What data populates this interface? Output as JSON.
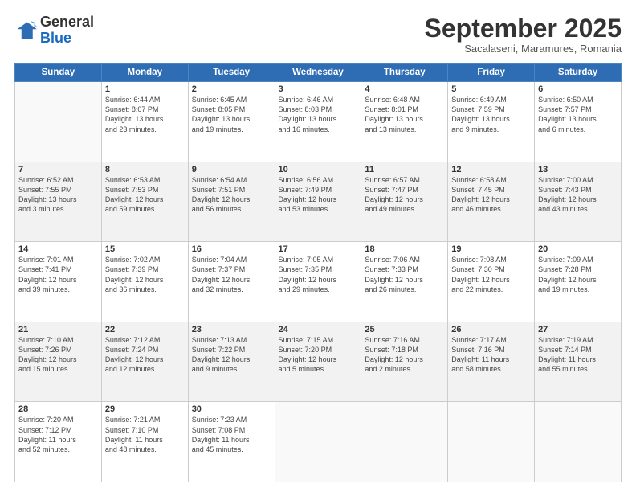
{
  "logo": {
    "general": "General",
    "blue": "Blue"
  },
  "header": {
    "month": "September 2025",
    "location": "Sacalaseni, Maramures, Romania"
  },
  "weekdays": [
    "Sunday",
    "Monday",
    "Tuesday",
    "Wednesday",
    "Thursday",
    "Friday",
    "Saturday"
  ],
  "weeks": [
    [
      {
        "day": "",
        "info": ""
      },
      {
        "day": "1",
        "info": "Sunrise: 6:44 AM\nSunset: 8:07 PM\nDaylight: 13 hours\nand 23 minutes."
      },
      {
        "day": "2",
        "info": "Sunrise: 6:45 AM\nSunset: 8:05 PM\nDaylight: 13 hours\nand 19 minutes."
      },
      {
        "day": "3",
        "info": "Sunrise: 6:46 AM\nSunset: 8:03 PM\nDaylight: 13 hours\nand 16 minutes."
      },
      {
        "day": "4",
        "info": "Sunrise: 6:48 AM\nSunset: 8:01 PM\nDaylight: 13 hours\nand 13 minutes."
      },
      {
        "day": "5",
        "info": "Sunrise: 6:49 AM\nSunset: 7:59 PM\nDaylight: 13 hours\nand 9 minutes."
      },
      {
        "day": "6",
        "info": "Sunrise: 6:50 AM\nSunset: 7:57 PM\nDaylight: 13 hours\nand 6 minutes."
      }
    ],
    [
      {
        "day": "7",
        "info": "Sunrise: 6:52 AM\nSunset: 7:55 PM\nDaylight: 13 hours\nand 3 minutes."
      },
      {
        "day": "8",
        "info": "Sunrise: 6:53 AM\nSunset: 7:53 PM\nDaylight: 12 hours\nand 59 minutes."
      },
      {
        "day": "9",
        "info": "Sunrise: 6:54 AM\nSunset: 7:51 PM\nDaylight: 12 hours\nand 56 minutes."
      },
      {
        "day": "10",
        "info": "Sunrise: 6:56 AM\nSunset: 7:49 PM\nDaylight: 12 hours\nand 53 minutes."
      },
      {
        "day": "11",
        "info": "Sunrise: 6:57 AM\nSunset: 7:47 PM\nDaylight: 12 hours\nand 49 minutes."
      },
      {
        "day": "12",
        "info": "Sunrise: 6:58 AM\nSunset: 7:45 PM\nDaylight: 12 hours\nand 46 minutes."
      },
      {
        "day": "13",
        "info": "Sunrise: 7:00 AM\nSunset: 7:43 PM\nDaylight: 12 hours\nand 43 minutes."
      }
    ],
    [
      {
        "day": "14",
        "info": "Sunrise: 7:01 AM\nSunset: 7:41 PM\nDaylight: 12 hours\nand 39 minutes."
      },
      {
        "day": "15",
        "info": "Sunrise: 7:02 AM\nSunset: 7:39 PM\nDaylight: 12 hours\nand 36 minutes."
      },
      {
        "day": "16",
        "info": "Sunrise: 7:04 AM\nSunset: 7:37 PM\nDaylight: 12 hours\nand 32 minutes."
      },
      {
        "day": "17",
        "info": "Sunrise: 7:05 AM\nSunset: 7:35 PM\nDaylight: 12 hours\nand 29 minutes."
      },
      {
        "day": "18",
        "info": "Sunrise: 7:06 AM\nSunset: 7:33 PM\nDaylight: 12 hours\nand 26 minutes."
      },
      {
        "day": "19",
        "info": "Sunrise: 7:08 AM\nSunset: 7:30 PM\nDaylight: 12 hours\nand 22 minutes."
      },
      {
        "day": "20",
        "info": "Sunrise: 7:09 AM\nSunset: 7:28 PM\nDaylight: 12 hours\nand 19 minutes."
      }
    ],
    [
      {
        "day": "21",
        "info": "Sunrise: 7:10 AM\nSunset: 7:26 PM\nDaylight: 12 hours\nand 15 minutes."
      },
      {
        "day": "22",
        "info": "Sunrise: 7:12 AM\nSunset: 7:24 PM\nDaylight: 12 hours\nand 12 minutes."
      },
      {
        "day": "23",
        "info": "Sunrise: 7:13 AM\nSunset: 7:22 PM\nDaylight: 12 hours\nand 9 minutes."
      },
      {
        "day": "24",
        "info": "Sunrise: 7:15 AM\nSunset: 7:20 PM\nDaylight: 12 hours\nand 5 minutes."
      },
      {
        "day": "25",
        "info": "Sunrise: 7:16 AM\nSunset: 7:18 PM\nDaylight: 12 hours\nand 2 minutes."
      },
      {
        "day": "26",
        "info": "Sunrise: 7:17 AM\nSunset: 7:16 PM\nDaylight: 11 hours\nand 58 minutes."
      },
      {
        "day": "27",
        "info": "Sunrise: 7:19 AM\nSunset: 7:14 PM\nDaylight: 11 hours\nand 55 minutes."
      }
    ],
    [
      {
        "day": "28",
        "info": "Sunrise: 7:20 AM\nSunset: 7:12 PM\nDaylight: 11 hours\nand 52 minutes."
      },
      {
        "day": "29",
        "info": "Sunrise: 7:21 AM\nSunset: 7:10 PM\nDaylight: 11 hours\nand 48 minutes."
      },
      {
        "day": "30",
        "info": "Sunrise: 7:23 AM\nSunset: 7:08 PM\nDaylight: 11 hours\nand 45 minutes."
      },
      {
        "day": "",
        "info": ""
      },
      {
        "day": "",
        "info": ""
      },
      {
        "day": "",
        "info": ""
      },
      {
        "day": "",
        "info": ""
      }
    ]
  ]
}
